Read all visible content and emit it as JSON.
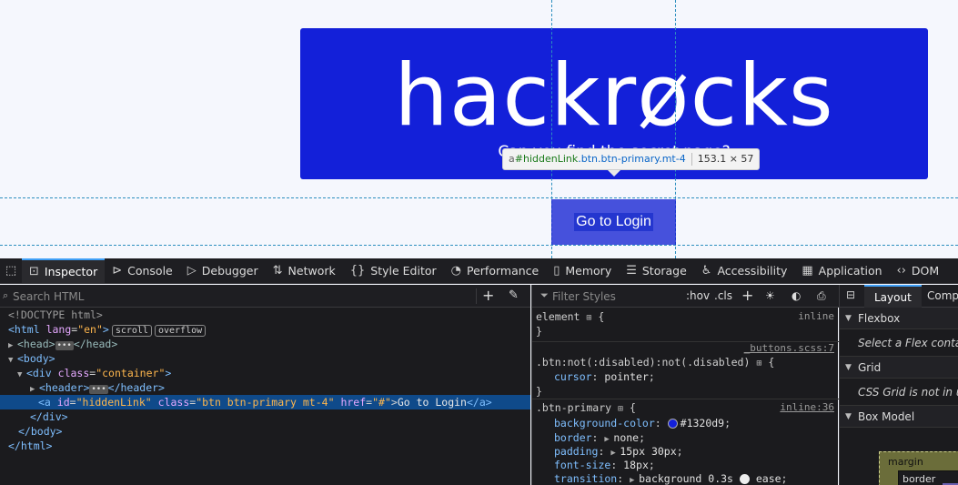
{
  "page": {
    "logo_text": "hackrøcks",
    "subtitle": "Can you find the secret page?",
    "button_label": "Go to Login",
    "tooltip": {
      "tag": "a",
      "id": "#hiddenLink",
      "classes": ".btn.btn-primary.mt-4",
      "dims": "153.1 × 57"
    }
  },
  "devtools": {
    "tabs": [
      {
        "label": "Inspector",
        "icon": "inspector-icon"
      },
      {
        "label": "Console",
        "icon": "console-icon"
      },
      {
        "label": "Debugger",
        "icon": "debugger-icon"
      },
      {
        "label": "Network",
        "icon": "network-icon"
      },
      {
        "label": "Style Editor",
        "icon": "braces-icon"
      },
      {
        "label": "Performance",
        "icon": "gauge-icon"
      },
      {
        "label": "Memory",
        "icon": "memory-icon"
      },
      {
        "label": "Storage",
        "icon": "storage-icon"
      },
      {
        "label": "Accessibility",
        "icon": "accessibility-icon"
      },
      {
        "label": "Application",
        "icon": "grid-icon"
      },
      {
        "label": "DOM",
        "icon": "dom-icon"
      }
    ],
    "search_placeholder": "Search HTML",
    "markup": {
      "doctype": "<!DOCTYPE html>",
      "html_open": {
        "tag": "<html",
        "attr": "lang",
        "val": "\"en\"",
        "close": ">",
        "badges": [
          "scroll",
          "overflow"
        ]
      },
      "head": {
        "open": "<head>",
        "close": "</head>"
      },
      "body_open": "<body>",
      "div_open": {
        "tag": "<div",
        "attr": "class",
        "val": "\"container\"",
        "close": ">"
      },
      "header": {
        "open": "<header>",
        "close": "</header>"
      },
      "anchor": {
        "tag": "<a",
        "a1": "id",
        "v1": "\"hiddenLink\"",
        "a2": "class",
        "v2": "\"btn btn-primary mt-4\"",
        "a3": "href",
        "v3": "\"#\"",
        "text": "Go to Login",
        "close": "</a>"
      },
      "div_close": "</div>",
      "body_close": "</body>",
      "html_close": "</html>"
    },
    "styles": {
      "filter_placeholder": "Filter Styles",
      "hov": ":hov",
      "cls": ".cls",
      "rules": {
        "element": {
          "selector": "element",
          "brace": "{",
          "source": "inline",
          "end": "}"
        },
        "btn": {
          "source": "_buttons.scss:7",
          "selector": ".btn:not(:disabled):not(.disabled)",
          "brace": "{",
          "prop": "cursor",
          "val": "pointer",
          "end": "}"
        },
        "primary": {
          "selector": ".btn-primary",
          "brace": "{",
          "source": "inline:36",
          "decls": [
            {
              "prop": "background-color",
              "val": "#1320d9"
            },
            {
              "prop": "border",
              "val": "none"
            },
            {
              "prop": "padding",
              "val": "15px 30px"
            },
            {
              "prop": "font-size",
              "val": "18px"
            },
            {
              "prop": "transition",
              "val": "background 0.3s",
              "val2": "ease"
            }
          ]
        }
      }
    },
    "layout": {
      "tab_layout": "Layout",
      "tab_computed": "Computed",
      "flexbox": {
        "title": "Flexbox",
        "body": "Select a Flex container or item to continue."
      },
      "grid": {
        "title": "Grid",
        "body": "CSS Grid is not in use on this page"
      },
      "boxmodel": {
        "title": "Box Model",
        "margin": "margin",
        "border": "border"
      }
    }
  }
}
